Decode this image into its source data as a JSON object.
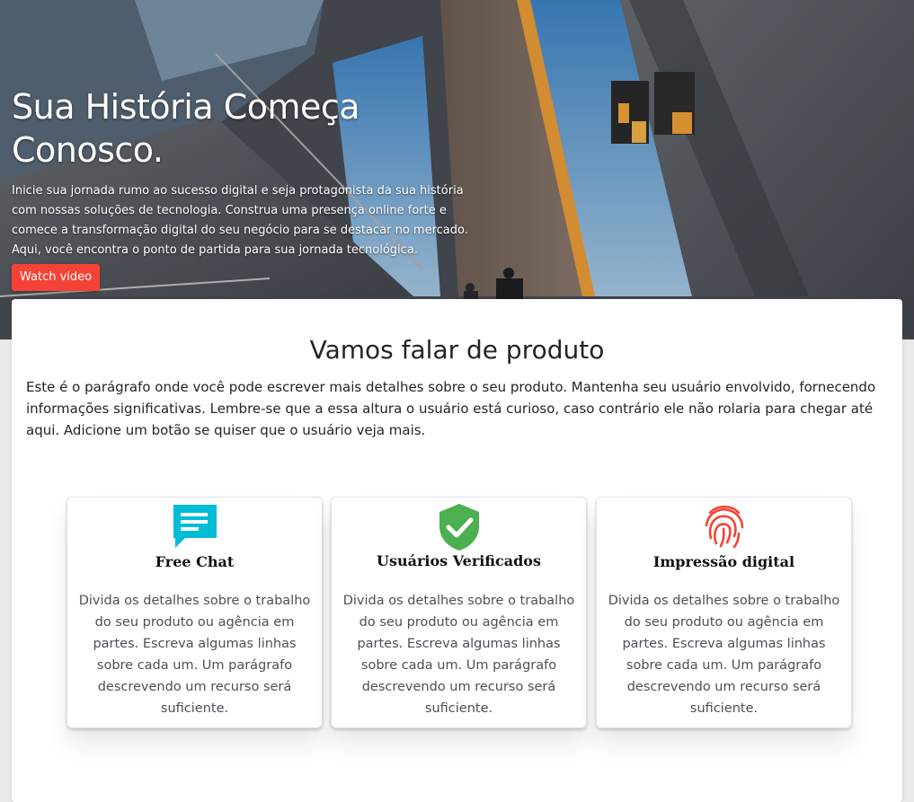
{
  "hero": {
    "title": "Sua História Começa Conosco.",
    "text": "Inicie sua jornada rumo ao sucesso digital e seja protagonista da sua história com nossas soluções de tecnologia. Construa uma presença online forte e comece a transformação digital do seu negócio para se destacar no mercado. Aqui, você encontra o ponto de partida para sua jornada tecnológica.",
    "button_label": "Watch video",
    "button_color": "#f44336"
  },
  "product": {
    "title": "Vamos falar de produto",
    "text": "Este é o parágrafo onde você pode escrever mais detalhes sobre o seu produto. Mantenha seu usuário envolvido, fornecendo informações significativas. Lembre-se que a essa altura o usuário está curioso, caso contrário ele não rolaria para chegar até aqui. Adicione um botão se quiser que o usuário veja mais."
  },
  "features": [
    {
      "icon": "chat-icon",
      "icon_color": "#00bcd4",
      "title": "Free Chat",
      "text": "Divida os detalhes sobre o trabalho do seu produto ou agência em partes. Escreva algumas linhas sobre cada um. Um parágrafo descrevendo um recurso será suficiente."
    },
    {
      "icon": "verified-shield-icon",
      "icon_color": "#4caf50",
      "title": "Usuários Verificados",
      "text": "Divida os detalhes sobre o trabalho do seu produto ou agência em partes. Escreva algumas linhas sobre cada um. Um parágrafo descrevendo um recurso será suficiente."
    },
    {
      "icon": "fingerprint-icon",
      "icon_color": "#f44336",
      "title": "Impressão digital",
      "text": "Divida os detalhes sobre o trabalho do seu produto ou agência em partes. Escreva algumas linhas sobre cada um. Um parágrafo descrevendo um recurso será suficiente."
    }
  ]
}
